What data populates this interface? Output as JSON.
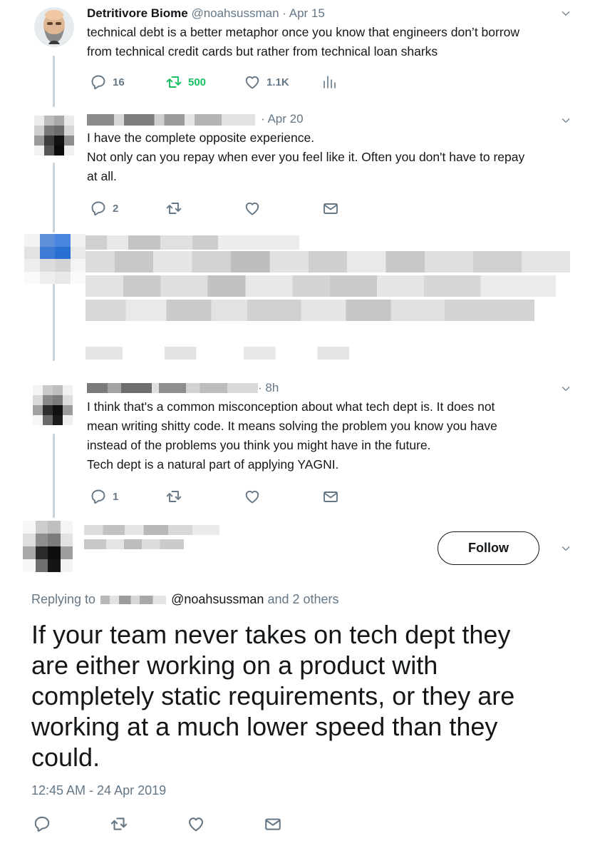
{
  "thread": [
    {
      "author_name": "Detritivore Biome",
      "handle": "@noahsussman",
      "date": "Apr 15",
      "lines": [
        "technical debt is a better metaphor once you know that engineers don’t borrow",
        "from technical credit cards but rather from technical loan sharks"
      ],
      "counts": {
        "replies": "16",
        "retweets": "500",
        "likes": "1.1K"
      },
      "icons": [
        "reply-icon",
        "retweet-icon",
        "like-icon",
        "analytics-icon"
      ]
    },
    {
      "date": "Apr 20",
      "lines": [
        "I have the complete opposite experience.",
        "Not only can you repay when ever you feel like it. Often you don't have to repay",
        "at all."
      ],
      "counts": {
        "replies": "2"
      },
      "icons": [
        "reply-icon",
        "retweet-icon",
        "like-icon",
        "dm-icon"
      ]
    },
    {
      "date": "8h",
      "lines": [
        "I think that's a common misconception about what tech dept is. It does not",
        "mean writing shitty code. It means solving the problem you know you have",
        "instead of the problems you think you might have in the future.",
        "Tech dept is a natural part of applying YAGNI."
      ],
      "counts": {
        "replies": "1"
      },
      "icons": [
        "reply-icon",
        "retweet-icon",
        "like-icon",
        "dm-icon"
      ]
    }
  ],
  "main_tweet": {
    "follow_label": "Follow",
    "replying_prefix": "Replying to",
    "replying_mention": "@noahsussman",
    "replying_suffix": "and 2 others",
    "lines": [
      "If your team never takes on tech dept they",
      "are either working on a product with",
      "completely static requirements, or they are",
      "working at a much lower speed than they",
      "could."
    ],
    "timestamp": "12:45 AM - 24 Apr 2019",
    "icons": [
      "reply-icon",
      "retweet-icon",
      "like-icon",
      "dm-icon"
    ]
  },
  "colors": {
    "text": "#14171a",
    "secondary": "#657786",
    "retweet_active": "#17bf63",
    "thread_line": "#c9d2d9"
  }
}
